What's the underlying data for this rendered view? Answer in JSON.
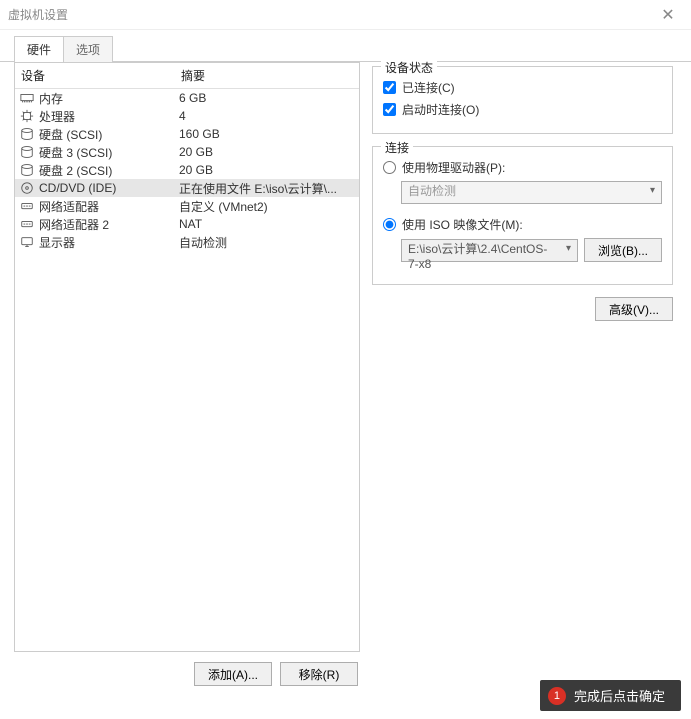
{
  "window": {
    "title": "虚拟机设置",
    "close_glyph": "✕"
  },
  "tabs": {
    "hardware": "硬件",
    "options": "选项"
  },
  "hwlist": {
    "hdr_device": "设备",
    "hdr_summary": "摘要",
    "rows": [
      {
        "icon": "memory",
        "name": "内存",
        "summary": "6 GB"
      },
      {
        "icon": "cpu",
        "name": "处理器",
        "summary": "4"
      },
      {
        "icon": "disk",
        "name": "硬盘 (SCSI)",
        "summary": "160 GB"
      },
      {
        "icon": "disk",
        "name": "硬盘 3 (SCSI)",
        "summary": "20 GB"
      },
      {
        "icon": "disk",
        "name": "硬盘 2 (SCSI)",
        "summary": "20 GB"
      },
      {
        "icon": "cd",
        "name": "CD/DVD (IDE)",
        "summary": "正在使用文件 E:\\iso\\云计算\\..."
      },
      {
        "icon": "net",
        "name": "网络适配器",
        "summary": "自定义 (VMnet2)"
      },
      {
        "icon": "net",
        "name": "网络适配器 2",
        "summary": "NAT"
      },
      {
        "icon": "display",
        "name": "显示器",
        "summary": "自动检测"
      }
    ],
    "selected_index": 5
  },
  "buttons": {
    "add": "添加(A)...",
    "remove": "移除(R)",
    "browse": "浏览(B)...",
    "advanced": "高级(V)..."
  },
  "status_group": {
    "legend": "设备状态",
    "connected": "已连接(C)",
    "connect_at_power": "启动时连接(O)"
  },
  "conn_group": {
    "legend": "连接",
    "use_physical": "使用物理驱动器(P):",
    "auto_detect": "自动检测",
    "use_iso": "使用 ISO 映像文件(M):",
    "iso_path": "E:\\iso\\云计算\\2.4\\CentOS-7-x8"
  },
  "banner": {
    "badge": "1",
    "text": "完成后点击确定"
  }
}
